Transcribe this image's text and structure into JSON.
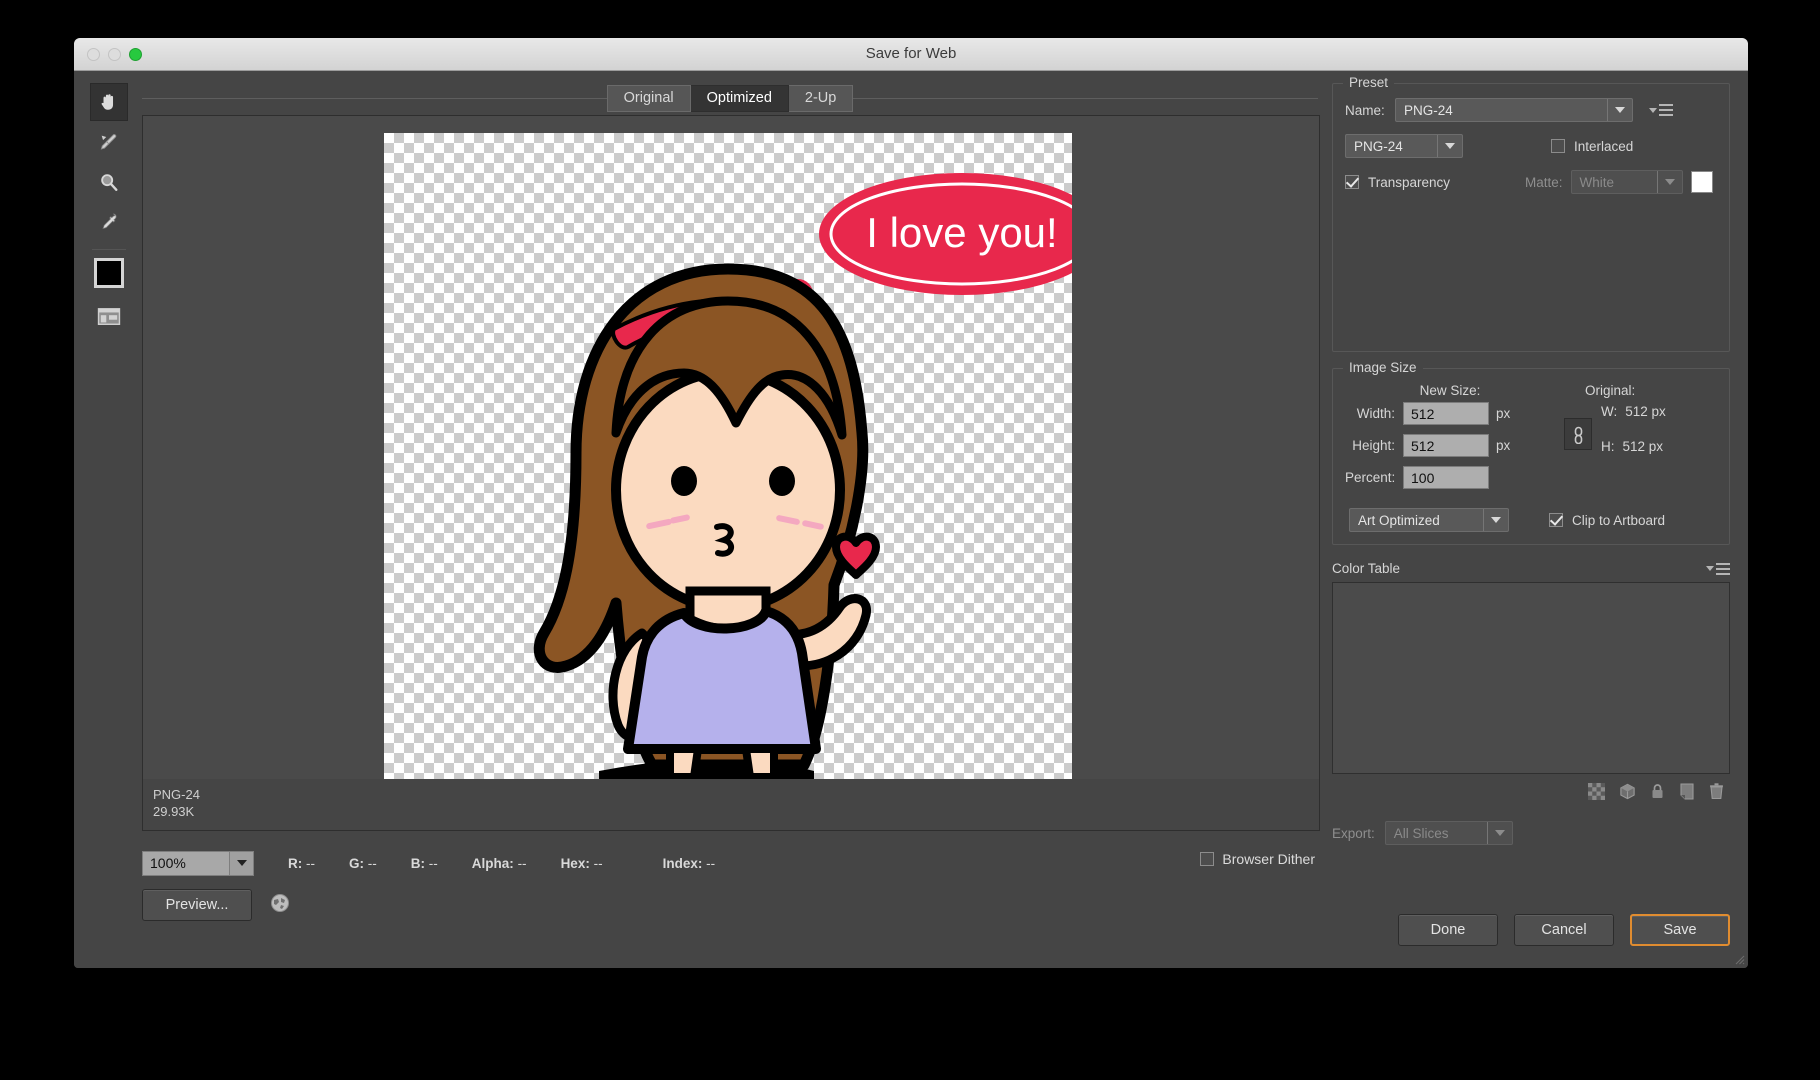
{
  "window": {
    "title": "Save for Web"
  },
  "tabs": [
    {
      "label": "Original",
      "selected": false
    },
    {
      "label": "Optimized",
      "selected": true
    },
    {
      "label": "2-Up",
      "selected": false
    }
  ],
  "toolbar": {
    "tools": [
      {
        "name": "hand-tool",
        "active": true
      },
      {
        "name": "slice-select-tool",
        "active": false
      },
      {
        "name": "zoom-tool",
        "active": false
      },
      {
        "name": "eyedropper-tool",
        "active": false
      }
    ],
    "foreground_color": "#000000"
  },
  "preview": {
    "file_format": "PNG-24",
    "file_size": "29.93K",
    "artwork": {
      "speech_bubble_text": "I love you!",
      "bubble_color": "#E8284C",
      "hair_color": "#8B5524",
      "skin_color": "#FBDAC0",
      "dress_color": "#B5B1EC",
      "headband_color": "#E8284C",
      "blush_color": "#F4A8C0",
      "outline_color": "#000000"
    }
  },
  "status": {
    "zoom": "100%",
    "readouts": [
      {
        "key": "R:",
        "value": "--"
      },
      {
        "key": "G:",
        "value": "--"
      },
      {
        "key": "B:",
        "value": "--"
      },
      {
        "key": "Alpha:",
        "value": "--"
      },
      {
        "key": "Hex:",
        "value": "--"
      },
      {
        "key": "Index:",
        "value": "--"
      }
    ],
    "browser_dither_label": "Browser Dither",
    "browser_dither_checked": false,
    "preview_button": "Preview..."
  },
  "preset": {
    "legend": "Preset",
    "name_label": "Name:",
    "name_value": "PNG-24",
    "format_value": "PNG-24",
    "interlaced_label": "Interlaced",
    "interlaced_checked": false,
    "transparency_label": "Transparency",
    "transparency_checked": true,
    "matte_label": "Matte:",
    "matte_value": "White",
    "matte_swatch": "#FFFFFF"
  },
  "image_size": {
    "legend": "Image Size",
    "new_size_label": "New Size:",
    "original_label": "Original:",
    "width_label": "Width:",
    "width_value": "512",
    "width_unit": "px",
    "height_label": "Height:",
    "height_value": "512",
    "height_unit": "px",
    "percent_label": "Percent:",
    "percent_value": "100",
    "orig_w_label": "W:",
    "orig_w_value": "512 px",
    "orig_h_label": "H:",
    "orig_h_value": "512 px",
    "quality_value": "Art Optimized",
    "clip_label": "Clip to Artboard",
    "clip_checked": true
  },
  "color_table": {
    "legend": "Color Table",
    "icons": [
      "transparency-icon",
      "web-safe-cube-icon",
      "lock-icon",
      "new-color-icon",
      "trash-icon"
    ]
  },
  "export": {
    "label": "Export:",
    "value": "All Slices"
  },
  "actions": {
    "done": "Done",
    "cancel": "Cancel",
    "save": "Save"
  }
}
